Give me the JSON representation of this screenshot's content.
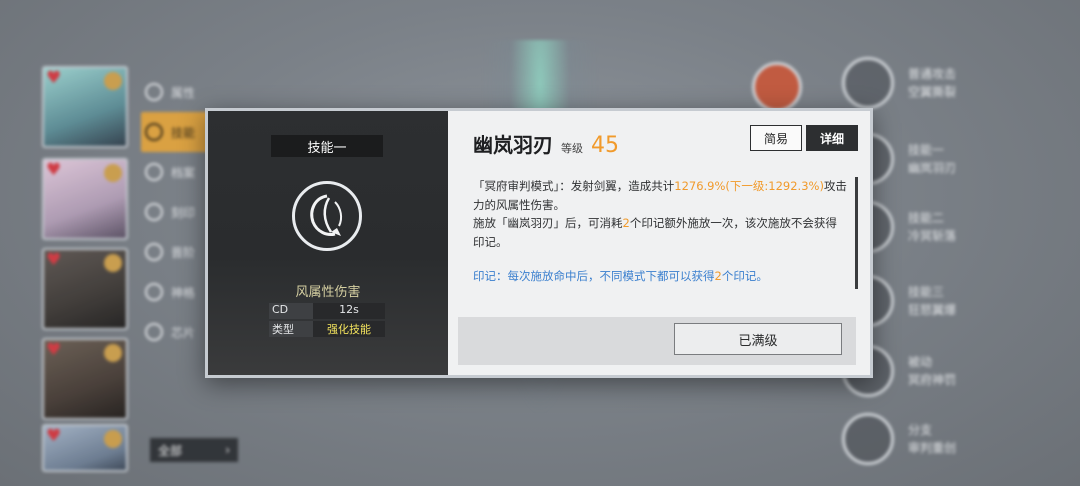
{
  "background": {
    "side_menu": [
      {
        "label": "属性"
      },
      {
        "label": "技能"
      },
      {
        "label": "档案"
      },
      {
        "label": "刻印"
      },
      {
        "label": "晋阶"
      },
      {
        "label": "神格"
      },
      {
        "label": "芯片"
      }
    ],
    "all_button": {
      "label": "全部",
      "arrow": "›"
    },
    "right_skills": [
      {
        "line1": "普通攻击",
        "line2": "空翼撕裂"
      },
      {
        "line1": "技能一",
        "line2": "幽岚羽刃"
      },
      {
        "line1": "技能二",
        "line2": "冷冥斩落"
      },
      {
        "line1": "技能三",
        "line2": "狂怒翼爆"
      },
      {
        "line1": "被动",
        "line2": "冥府神罚"
      },
      {
        "line1": "分支",
        "line2": "审判重创"
      }
    ]
  },
  "dialog": {
    "skill_slot": "技能一",
    "damage_type": "风属性伤害",
    "stats": [
      {
        "key": "CD",
        "value": "12s"
      },
      {
        "key": "类型",
        "value": "强化技能"
      }
    ],
    "skill_name": "幽岚羽刃",
    "level_label": "等级",
    "level_value": "45",
    "tabs": [
      {
        "label": "简易",
        "active": false
      },
      {
        "label": "详细",
        "active": true
      }
    ],
    "description": {
      "p1_a": "「冥府审判模式」：发射剑翼，造成共计",
      "p1_b": "1276.9%(下一级:1292.3%)",
      "p1_c": "攻击力的风属性伤害。",
      "p2_a": "施放「幽岚羽刃」后，可消耗",
      "p2_b": "2",
      "p2_c": "个印记额外施放一次，该次施放不会获得印记。",
      "p3_a": "印记：每次施放命中后，不同模式下都可以获得",
      "p3_b": "2",
      "p3_c": "个印记。"
    },
    "maxed_button": "已满级"
  },
  "colors": {
    "accent_orange": "#f19a2b",
    "note_blue": "#3a7fce",
    "type_yellow": "#f3e35d",
    "dark_panel": "#2d2f31"
  }
}
